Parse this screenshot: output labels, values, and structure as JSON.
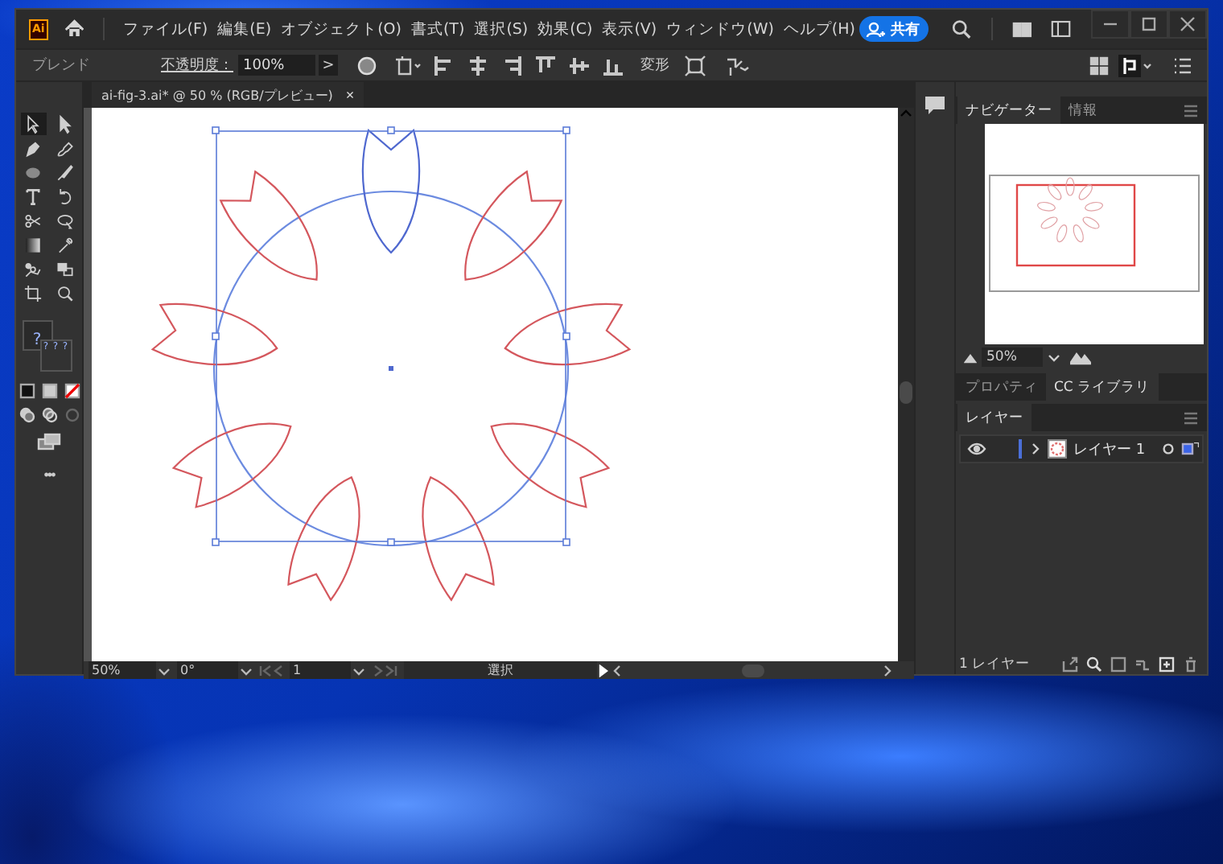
{
  "menu_bar": {
    "app_logo": "Ai",
    "items": [
      "ファイル(F)",
      "編集(E)",
      "オブジェクト(O)",
      "書式(T)",
      "選択(S)",
      "効果(C)",
      "表示(V)",
      "ウィンドウ(W)",
      "ヘルプ(H)"
    ],
    "share_button": "共有"
  },
  "control_bar": {
    "object_type": "ブレンド",
    "opacity_label": "不透明度：",
    "opacity_value": "100%",
    "more_button": ">",
    "transform_button": "変形"
  },
  "toolbar": {
    "tools": [
      {
        "kind": "select",
        "selected": true
      },
      {
        "kind": "direct",
        "selected": false
      },
      {
        "kind": "pen",
        "selected": false
      },
      {
        "kind": "curvature",
        "selected": false
      },
      {
        "kind": "ellipse",
        "selected": false
      },
      {
        "kind": "brush",
        "selected": false
      },
      {
        "kind": "type",
        "selected": false
      },
      {
        "kind": "rotate",
        "selected": false
      },
      {
        "kind": "scissors",
        "selected": false
      },
      {
        "kind": "lasso",
        "selected": false
      },
      {
        "kind": "gradient",
        "selected": false
      },
      {
        "kind": "eyedropper",
        "selected": false
      },
      {
        "kind": "blend",
        "selected": false
      },
      {
        "kind": "shapebuilder",
        "selected": false
      },
      {
        "kind": "artboard",
        "selected": false
      },
      {
        "kind": "zoom",
        "selected": false
      }
    ],
    "fill_mark": "?",
    "stroke_marks": [
      "?",
      "?",
      "?"
    ],
    "more": "•••"
  },
  "document": {
    "tab_title": "ai-fig-3.ai* @ 50 % (RGB/プレビュー)",
    "close": "×"
  },
  "status_bar": {
    "zoom": "50%",
    "rotation": "0°",
    "artboard": "1",
    "tool": "選択"
  },
  "navigator_panel": {
    "tabs": [
      {
        "label": "ナビゲーター",
        "selected": true
      },
      {
        "label": "情報",
        "selected": false
      }
    ],
    "zoom": "50%"
  },
  "library_panel": {
    "tabs": [
      {
        "label": "プロパティ",
        "selected": false
      },
      {
        "label": "CC ライブラリ",
        "selected": true
      }
    ]
  },
  "layers_panel": {
    "tabs": [
      {
        "label": "レイヤー",
        "selected": true
      }
    ],
    "layers": [
      {
        "name": "レイヤー 1",
        "visible": true,
        "expanded": false,
        "color": "#4b6fd8"
      }
    ],
    "footer": "1 レイヤー"
  }
}
